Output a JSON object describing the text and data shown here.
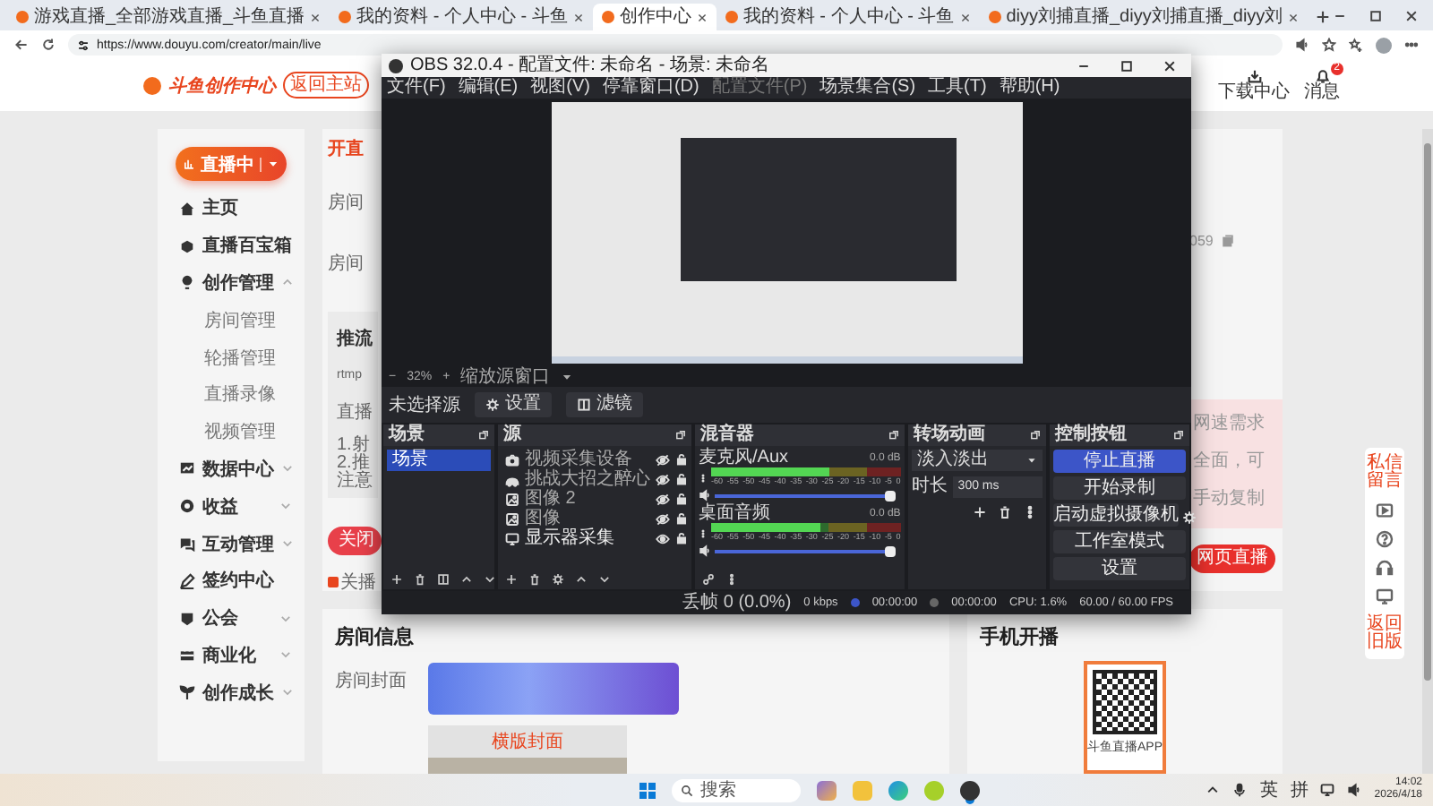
{
  "browser": {
    "tabs": [
      {
        "title": "游戏直播_全部游戏直播_斗鱼直播",
        "selected": false
      },
      {
        "title": "我的资料 - 个人中心 - 斗鱼",
        "selected": false
      },
      {
        "title": "创作中心",
        "selected": true
      },
      {
        "title": "我的资料 - 个人中心 - 斗鱼",
        "selected": false
      },
      {
        "title": "diyy刘捕直播_diyy刘捕直播_diyy刘",
        "selected": false
      }
    ],
    "url": "https://www.douyu.com/creator/main/live"
  },
  "header": {
    "logo": "斗鱼创作中心",
    "back_button": "返回主站",
    "download": "下载中心",
    "messages": "消息",
    "message_badge": "2"
  },
  "sidebar": {
    "live_button": "直播中",
    "items": [
      {
        "label": "主页",
        "kind": "link"
      },
      {
        "label": "直播百宝箱",
        "kind": "link"
      },
      {
        "label": "创作管理",
        "kind": "group",
        "expanded": true,
        "children": [
          {
            "label": "房间管理"
          },
          {
            "label": "轮播管理"
          },
          {
            "label": "直播录像"
          },
          {
            "label": "视频管理"
          }
        ]
      },
      {
        "label": "数据中心",
        "kind": "group",
        "expanded": false
      },
      {
        "label": "收益",
        "kind": "group",
        "expanded": false
      },
      {
        "label": "互动管理",
        "kind": "group",
        "expanded": false
      },
      {
        "label": "签约中心",
        "kind": "link"
      },
      {
        "label": "公会",
        "kind": "group",
        "expanded": false
      },
      {
        "label": "商业化",
        "kind": "group",
        "expanded": false
      },
      {
        "label": "创作成长",
        "kind": "group",
        "expanded": false
      }
    ]
  },
  "live_card": {
    "title": "开直",
    "fields": [
      "房间",
      "房间"
    ],
    "stream_box": {
      "title": "推流",
      "lines": [
        "rtmp",
        "直播"
      ],
      "notes": [
        "1.射",
        "2.推",
        "注意"
      ]
    },
    "close_button": "关闭",
    "auto_close": {
      "label": "关播",
      "checked": true
    },
    "key": "059",
    "notice_lines": [
      "网速需求",
      "全面，可",
      "手动复制"
    ],
    "web_live_button": "网页直播"
  },
  "room_info": {
    "title": "房间信息",
    "cover_label": "房间封面",
    "landscape_label": "横版封面"
  },
  "mobile": {
    "title": "手机开播",
    "caption": "斗鱼直播APP"
  },
  "float_bar": {
    "top_label": "私信留言",
    "bottom_label": "返回旧版"
  },
  "obs": {
    "title": "OBS 32.0.4 - 配置文件: 未命名 - 场景: 未命名",
    "menu": [
      {
        "label": "文件(F)",
        "disabled": false
      },
      {
        "label": "编辑(E)",
        "disabled": false
      },
      {
        "label": "视图(V)",
        "disabled": false
      },
      {
        "label": "停靠窗口(D)",
        "disabled": false
      },
      {
        "label": "配置文件(P)",
        "disabled": true
      },
      {
        "label": "场景集合(S)",
        "disabled": false
      },
      {
        "label": "工具(T)",
        "disabled": false
      },
      {
        "label": "帮助(H)",
        "disabled": false
      }
    ],
    "zoom": {
      "minus": "−",
      "value": "32%",
      "plus": "+",
      "mode": "缩放源窗口"
    },
    "source_bar": {
      "status": "未选择源",
      "settings": "设置",
      "filters": "滤镜"
    },
    "scenes": {
      "title": "场景",
      "items": [
        {
          "name": "场景",
          "selected": true
        }
      ]
    },
    "sources": {
      "title": "源",
      "items": [
        {
          "name": "视频采集设备",
          "kind": "camera",
          "visible": false
        },
        {
          "name": "挑战大招之醉心",
          "kind": "app",
          "visible": false
        },
        {
          "name": "图像 2",
          "kind": "image",
          "visible": false
        },
        {
          "name": "图像",
          "kind": "image",
          "visible": false
        },
        {
          "name": "显示器采集",
          "kind": "display",
          "visible": true
        }
      ]
    },
    "mixer": {
      "title": "混音器",
      "channels": [
        {
          "name": "麦克风/Aux",
          "reading": "0.0 dB",
          "level": 1,
          "meter": {
            "level": 0.62
          },
          "scale": [
            "-60",
            "-55",
            "-50",
            "-45",
            "-40",
            "-35",
            "-30",
            "-25",
            "-20",
            "-15",
            "-10",
            "-5",
            "0"
          ]
        },
        {
          "name": "桌面音频",
          "reading": "0.0 dB",
          "level": 1,
          "meter": {
            "level": 0.58
          },
          "scale": [
            "-60",
            "-55",
            "-50",
            "-45",
            "-40",
            "-35",
            "-30",
            "-25",
            "-20",
            "-15",
            "-10",
            "-5",
            "0"
          ]
        }
      ]
    },
    "transitions": {
      "title": "转场动画",
      "selected": "淡入淡出",
      "duration_label": "时长",
      "duration": "300 ms"
    },
    "controls": {
      "title": "控制按钮",
      "buttons": [
        {
          "label": "停止直播",
          "active": true
        },
        {
          "label": "开始录制",
          "active": false
        },
        {
          "label": "启动虚拟摄像机",
          "active": false,
          "kind": "with-settings"
        },
        {
          "label": "工作室模式",
          "active": false
        },
        {
          "label": "设置",
          "active": false
        }
      ]
    },
    "status": {
      "dropped": "丢帧 0 (0.0%)",
      "bitrate": "0 kbps",
      "stream_time": "00:00:00",
      "record_time": "00:00:00",
      "cpu": "CPU: 1.6%",
      "fps": "60.00 / 60.00 FPS"
    }
  },
  "taskbar": {
    "search": "搜索",
    "language": "英",
    "ime": "拼",
    "time": "14:02",
    "date": "2026/4/18"
  }
}
